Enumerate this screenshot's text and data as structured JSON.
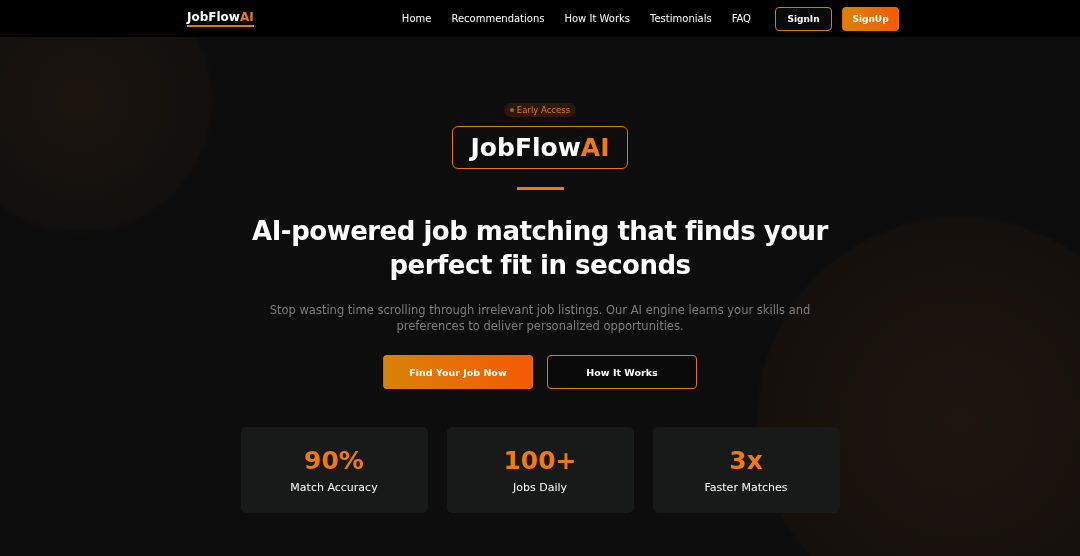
{
  "nav": {
    "logo": {
      "name": "JobFlow",
      "accent": "AI"
    },
    "links": [
      "Home",
      "Recommendations",
      "How It Works",
      "Testimonials",
      "FAQ"
    ],
    "buttons": [
      {
        "label": "SignIn",
        "kind": "outline"
      },
      {
        "label": "SignUp",
        "kind": "filled"
      }
    ]
  },
  "hero": {
    "badge": "Early Access",
    "brand": {
      "name": "JobFlow",
      "accent": "AI"
    },
    "headline": "AI-powered job matching that finds your perfect fit in seconds",
    "subtitle": "Stop wasting time scrolling through irrelevant job listings. Our AI engine learns your skills and preferences to deliver personalized opportunities.",
    "buttons": [
      {
        "label": "Find Your Job Now",
        "kind": "filled"
      },
      {
        "label": "How It Works",
        "kind": "outline"
      }
    ],
    "stats": [
      {
        "value": "90%",
        "label": "Match Accuracy"
      },
      {
        "value": "100+",
        "label": "Jobs Daily"
      },
      {
        "value": "3x",
        "label": "Faster Matches"
      }
    ]
  }
}
